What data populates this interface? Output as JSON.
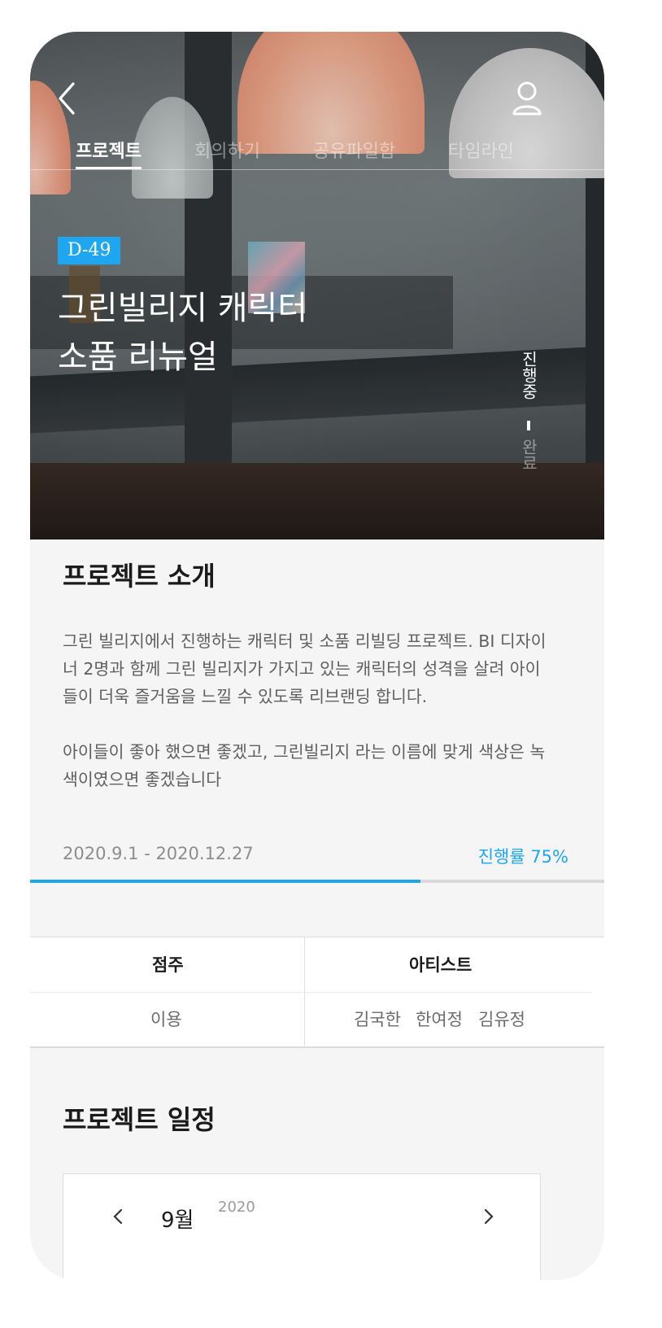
{
  "header": {
    "tabs": [
      {
        "label": "프로젝트",
        "active": true
      },
      {
        "label": "회의하기",
        "active": false
      },
      {
        "label": "공유파일함",
        "active": false
      },
      {
        "label": "타임라인",
        "active": false
      }
    ],
    "icons": {
      "back": "chevron-left-icon",
      "profile": "user-icon"
    }
  },
  "hero": {
    "dday": "D-49",
    "title_line1": "그린빌리지 캐릭터",
    "title_line2": "소품 리뉴얼",
    "status_active": "진행중",
    "status_inactive": "완료"
  },
  "intro": {
    "heading": "프로젝트 소개",
    "paragraph1": "그린 빌리지에서 진행하는 캐릭터 및 소품 리빌딩 프로젝트. BI 디자이너 2명과 함께 그린 빌리지가 가지고 있는 캐릭터의 성격을 살려 아이들이 더욱 즐거움을 느낄 수 있도록 리브랜딩 합니다.",
    "paragraph2": "아이들이 좋아 했으면 좋겠고, 그린빌리지 라는 이름에 맞게 색상은 녹색이였으면 좋겠습니다"
  },
  "progress": {
    "date_range": "2020.9.1 - 2020.12.27",
    "label": "진행률 75%",
    "value": 0.68
  },
  "team": {
    "owner_header": "점주",
    "artist_header": "아티스트",
    "owner": "이용",
    "artists": [
      "김국한",
      "한여정",
      "김유정"
    ]
  },
  "schedule": {
    "heading": "프로젝트 일정",
    "month": "9월",
    "year": "2020"
  },
  "colors": {
    "accent": "#1ea7f0",
    "background": "#f5f5f5",
    "text_dark": "#1b1b1b",
    "text_muted": "#5f5f5f"
  }
}
